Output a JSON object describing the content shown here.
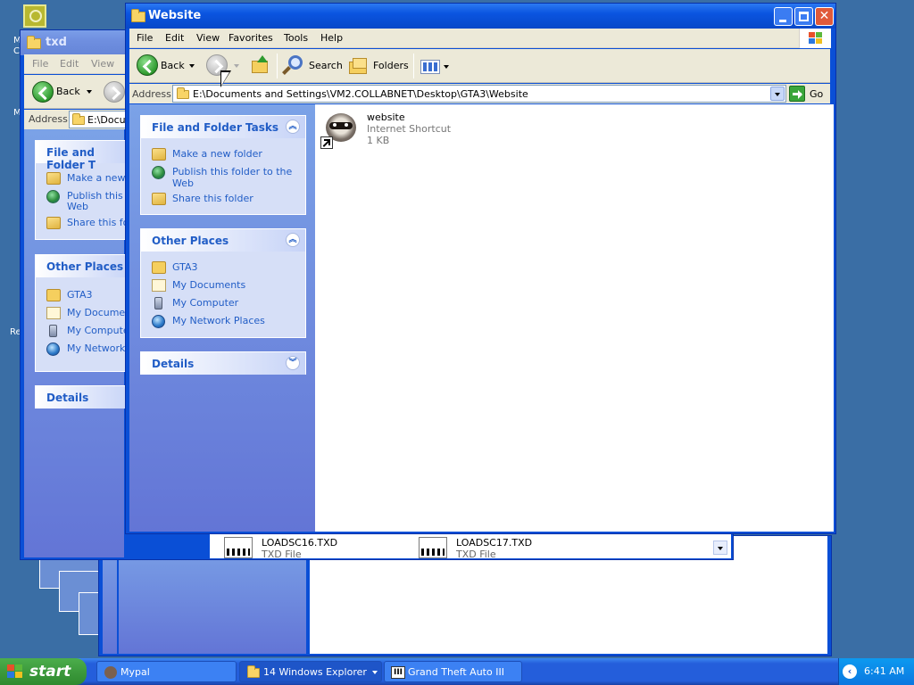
{
  "desktop": {
    "labels": [
      "M",
      "C",
      "M",
      "Re"
    ]
  },
  "txd_window": {
    "title": "txd",
    "menu": [
      "File",
      "Edit",
      "View"
    ],
    "back_label": "Back",
    "address_label": "Address",
    "address_value": "E:\\Docum",
    "panel_tasks_title": "File and Folder T",
    "tasks": [
      "Make a new f",
      "Publish this fo",
      "Web",
      "Share this fol"
    ],
    "panel_places_title": "Other Places",
    "places": [
      "GTA3",
      "My Document",
      "My Computer",
      "My Network P"
    ],
    "panel_details_title": "Details",
    "files": [
      {
        "name": "LOADSC16.TXD",
        "type": "TXD File"
      },
      {
        "name": "LOADSC17.TXD",
        "type": "TXD File"
      }
    ]
  },
  "website_window": {
    "title": "Website",
    "menu": [
      "File",
      "Edit",
      "View",
      "Favorites",
      "Tools",
      "Help"
    ],
    "toolbar": {
      "back_label": "Back",
      "search_label": "Search",
      "folders_label": "Folders"
    },
    "address_label": "Address",
    "address_value": "E:\\Documents and Settings\\VM2.COLLABNET\\Desktop\\GTA3\\Website",
    "go_label": "Go",
    "tasks_panel": {
      "title": "File and Folder Tasks",
      "items": [
        "Make a new folder",
        "Publish this folder to the",
        "Web",
        "Share this folder"
      ]
    },
    "places_panel": {
      "title": "Other Places",
      "items": [
        "GTA3",
        "My Documents",
        "My Computer",
        "My Network Places"
      ]
    },
    "details_panel": {
      "title": "Details"
    },
    "file_item": {
      "name": "website",
      "type": "Internet Shortcut",
      "size": "1 KB"
    }
  },
  "taskbar": {
    "start_label": "start",
    "buttons": [
      "Mypal",
      "14 Windows Explorer",
      "Grand Theft Auto III"
    ],
    "clock": "6:41 AM"
  },
  "colors": {
    "desktop": "#3a6ea5",
    "title_blue": "#0a54e0",
    "link_blue": "#215dc6",
    "start_green": "#3c9a3c"
  }
}
